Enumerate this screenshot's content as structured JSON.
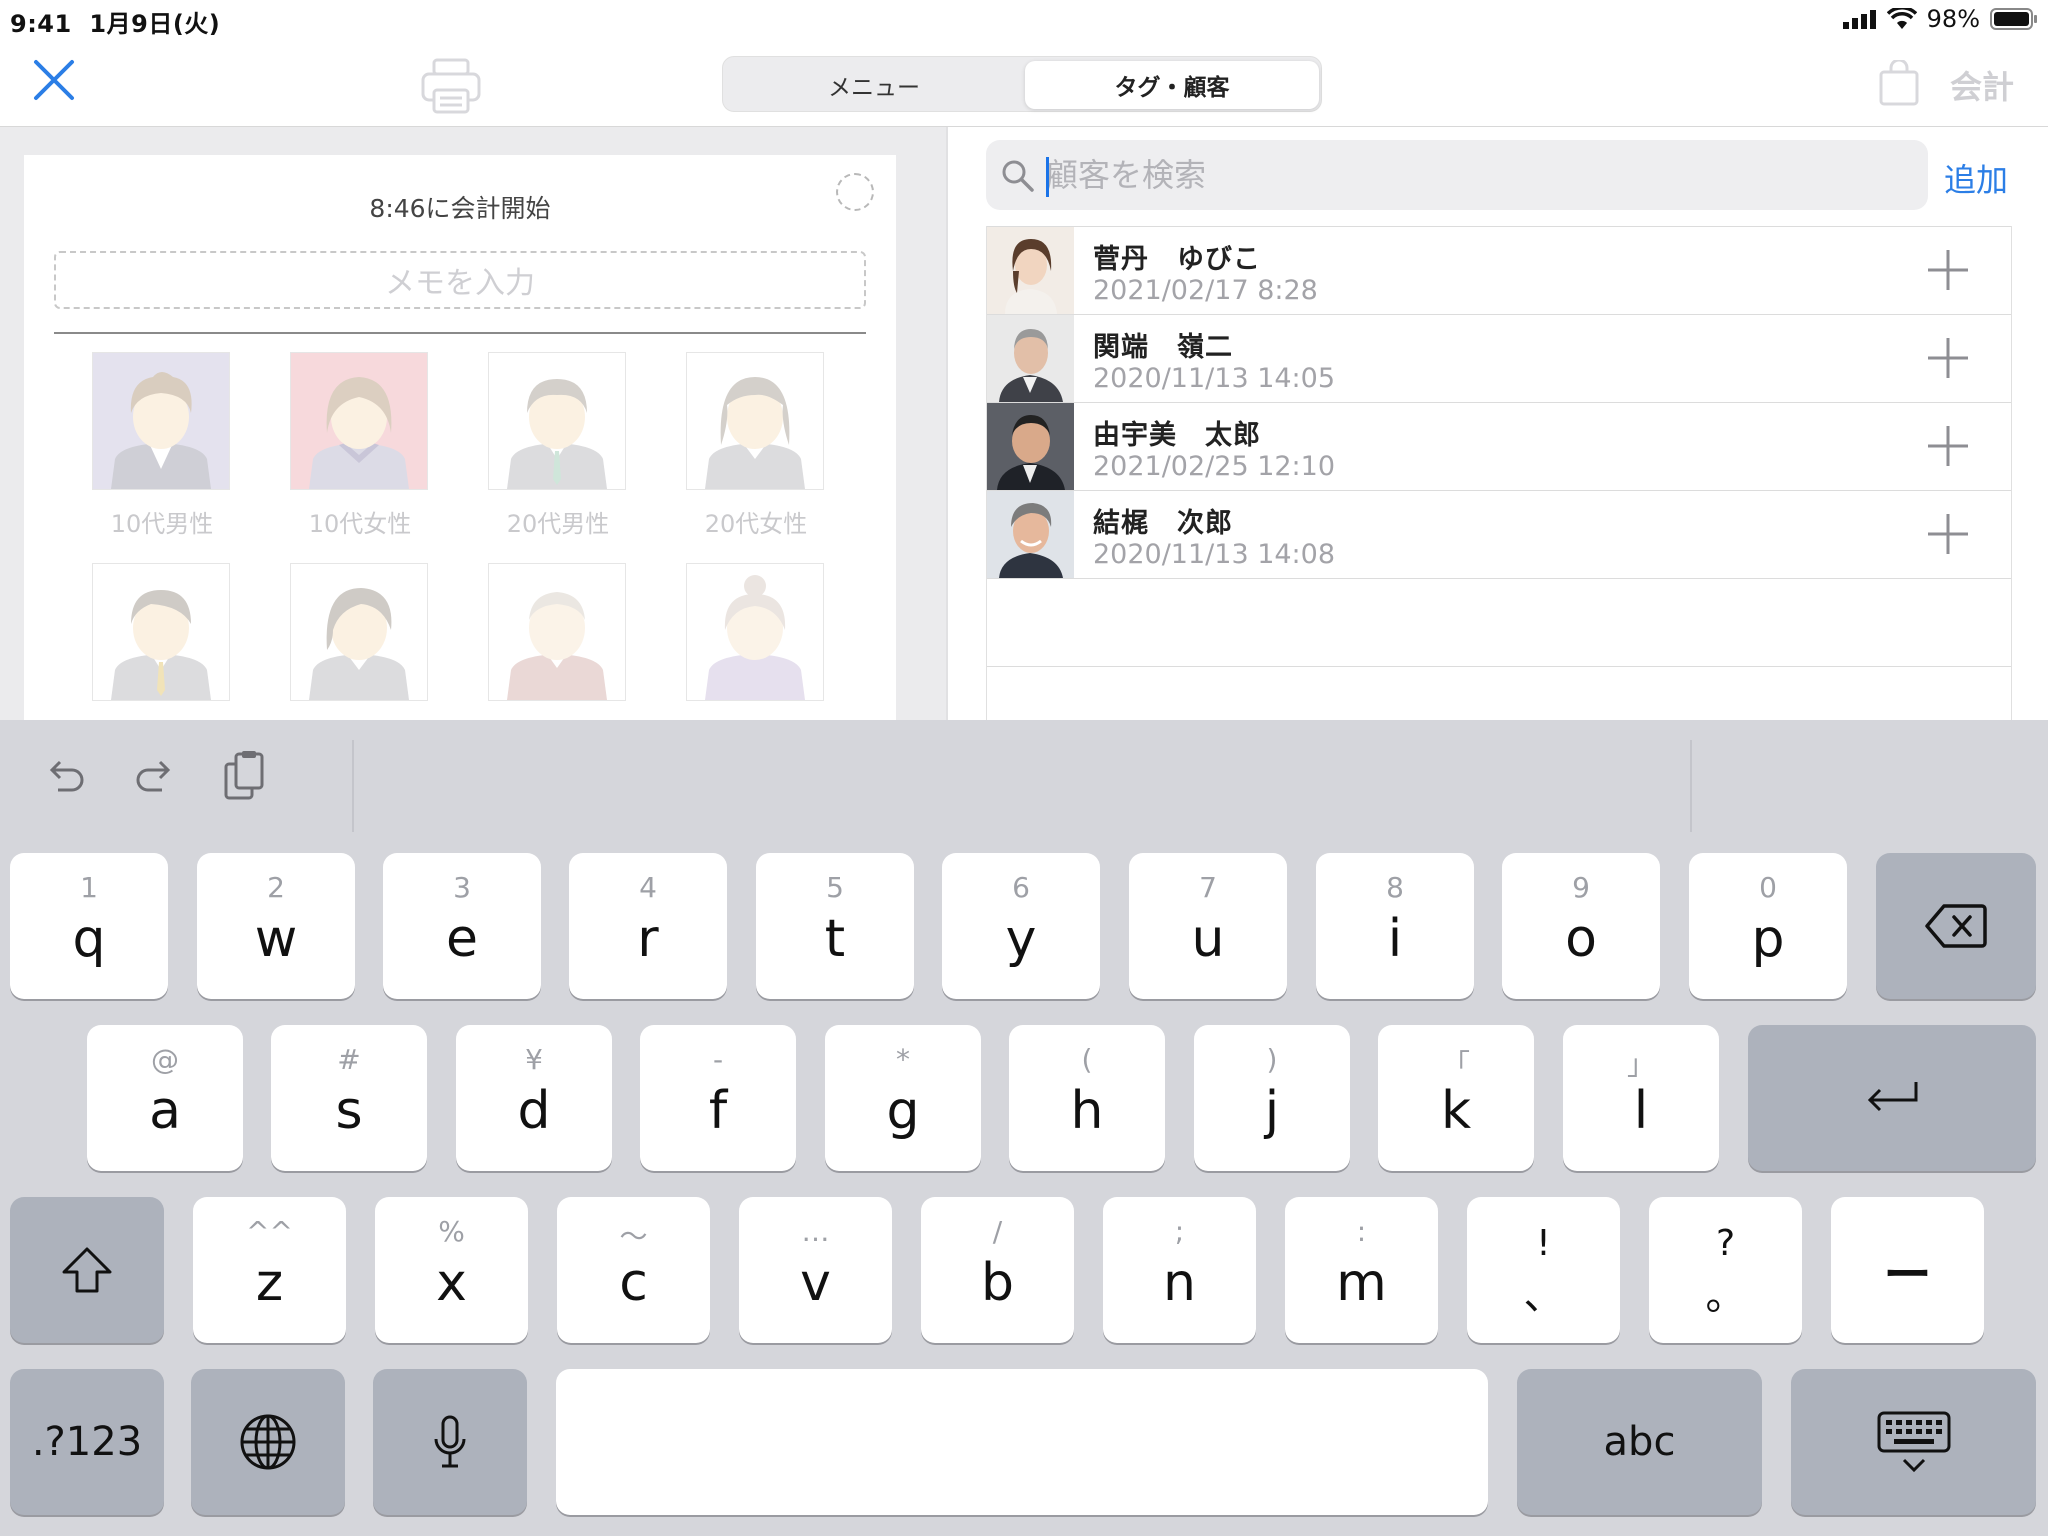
{
  "status": {
    "time": "9:41",
    "date": "1月9日(火)",
    "battery": "98%"
  },
  "nav": {
    "segments": [
      "メニュー",
      "タグ・顧客"
    ],
    "selected_segment": "タグ・顧客",
    "checkout_label": "会計"
  },
  "order": {
    "start_text": "8:46に会計開始",
    "memo_placeholder": "メモを入力"
  },
  "tags": [
    {
      "label": "10代男性",
      "icon": "teen-boy-avatar-icon",
      "bg": "#e4e2ee"
    },
    {
      "label": "10代女性",
      "icon": "teen-girl-avatar-icon",
      "bg": "#f7d9dc"
    },
    {
      "label": "20代男性",
      "icon": "twenties-man-avatar-icon",
      "bg": "#ffffff"
    },
    {
      "label": "20代女性",
      "icon": "twenties-woman-avatar-icon",
      "bg": "#ffffff"
    },
    {
      "label": "",
      "icon": "thirties-man-avatar-icon",
      "bg": "#ffffff"
    },
    {
      "label": "",
      "icon": "thirties-woman-avatar-icon",
      "bg": "#ffffff"
    },
    {
      "label": "",
      "icon": "elderly-man-avatar-icon",
      "bg": "#ffffff"
    },
    {
      "label": "",
      "icon": "elderly-woman-avatar-icon",
      "bg": "#ffffff"
    }
  ],
  "search": {
    "placeholder": "顧客を検索",
    "value": "",
    "add_label": "追加"
  },
  "customers": [
    {
      "name": "菅丹　ゆびこ",
      "date": "2021/02/17 8:28",
      "photo": "customer-photo-woman"
    },
    {
      "name": "関端　嶺二",
      "date": "2020/11/13 14:05",
      "photo": "customer-photo-older-man"
    },
    {
      "name": "由宇美　太郎",
      "date": "2021/02/25 12:10",
      "photo": "customer-photo-man-suit"
    },
    {
      "name": "結梶　次郎",
      "date": "2020/11/13 14:08",
      "photo": "customer-photo-smiling-man"
    }
  ],
  "keyboard": {
    "row1": [
      [
        "q",
        "1"
      ],
      [
        "w",
        "2"
      ],
      [
        "e",
        "3"
      ],
      [
        "r",
        "4"
      ],
      [
        "t",
        "5"
      ],
      [
        "y",
        "6"
      ],
      [
        "u",
        "7"
      ],
      [
        "i",
        "8"
      ],
      [
        "o",
        "9"
      ],
      [
        "p",
        "0"
      ]
    ],
    "row2": [
      [
        "a",
        "@"
      ],
      [
        "s",
        "#"
      ],
      [
        "d",
        "¥"
      ],
      [
        "f",
        "-"
      ],
      [
        "g",
        "*"
      ],
      [
        "h",
        "("
      ],
      [
        "j",
        ")"
      ],
      [
        "k",
        "「"
      ],
      [
        "l",
        "」"
      ]
    ],
    "row3": [
      [
        "z",
        "^^"
      ],
      [
        "x",
        "%"
      ],
      [
        "c",
        "〜"
      ],
      [
        "v",
        "…"
      ],
      [
        "b",
        "/"
      ],
      [
        "n",
        ";"
      ],
      [
        "m",
        ":"
      ],
      [
        "、",
        "!"
      ],
      [
        "。",
        "?"
      ]
    ],
    "dash_key": "ー",
    "numbers_key": ".?123",
    "abc_key": "abc"
  }
}
